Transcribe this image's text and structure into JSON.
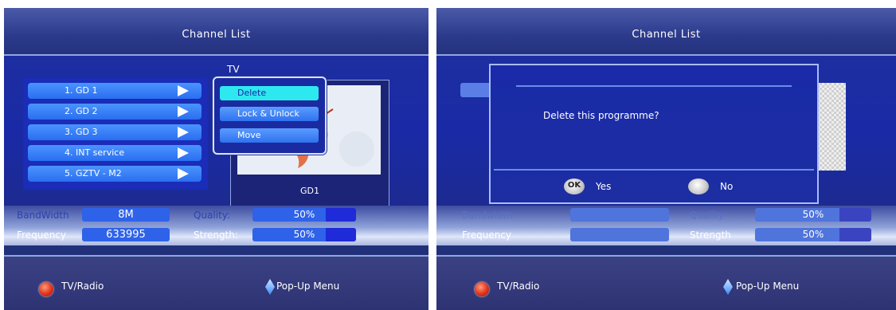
{
  "left_screen": {
    "title": "Channel List",
    "tv_label": "TV",
    "channels": [
      {
        "label": "1. GD 1"
      },
      {
        "label": "2. GD 2"
      },
      {
        "label": "3. GD 3"
      },
      {
        "label": "4. INT service"
      },
      {
        "label": "5. GZTV - M2"
      }
    ],
    "popup_menu": {
      "items": [
        {
          "label": "Delete",
          "selected": true
        },
        {
          "label": "Lock & Unlock",
          "selected": false
        },
        {
          "label": "Move",
          "selected": false
        }
      ]
    },
    "preview_name": "GD1",
    "signal": {
      "bandwidth_label": "BandWidth",
      "bandwidth_value": "8M",
      "frequency_label": "Frequency",
      "frequency_value": "633995",
      "quality_label": "Quality:",
      "quality_value": "50%",
      "strength_label": "Strength:",
      "strength_value": "50%"
    },
    "footer": {
      "tv_radio_label": "TV/Radio",
      "popup_menu_label": "Pop-Up Menu"
    }
  },
  "right_screen": {
    "title": "Channel List",
    "dialog": {
      "message": "Delete this programme?",
      "ok_label": "OK",
      "yes_label": "Yes",
      "no_label": "No"
    },
    "signal": {
      "bandwidth_label": "Bandwidth",
      "frequency_label": "Frequency",
      "quality_label": "Quality",
      "quality_value": "50%",
      "strength_label": "Strength",
      "strength_value": "50%"
    },
    "footer": {
      "tv_radio_label": "TV/Radio",
      "popup_menu_label": "Pop-Up Menu"
    }
  },
  "colors": {
    "accent": "#2ee8f0",
    "button_blue": "#3a82f6",
    "panel_blue": "#1a2aa6",
    "red_button": "#e0321a"
  },
  "icons": [
    "red-button-icon",
    "arrow-right-icon",
    "diamond-nav-icon",
    "ok-button-icon",
    "no-button-icon"
  ]
}
